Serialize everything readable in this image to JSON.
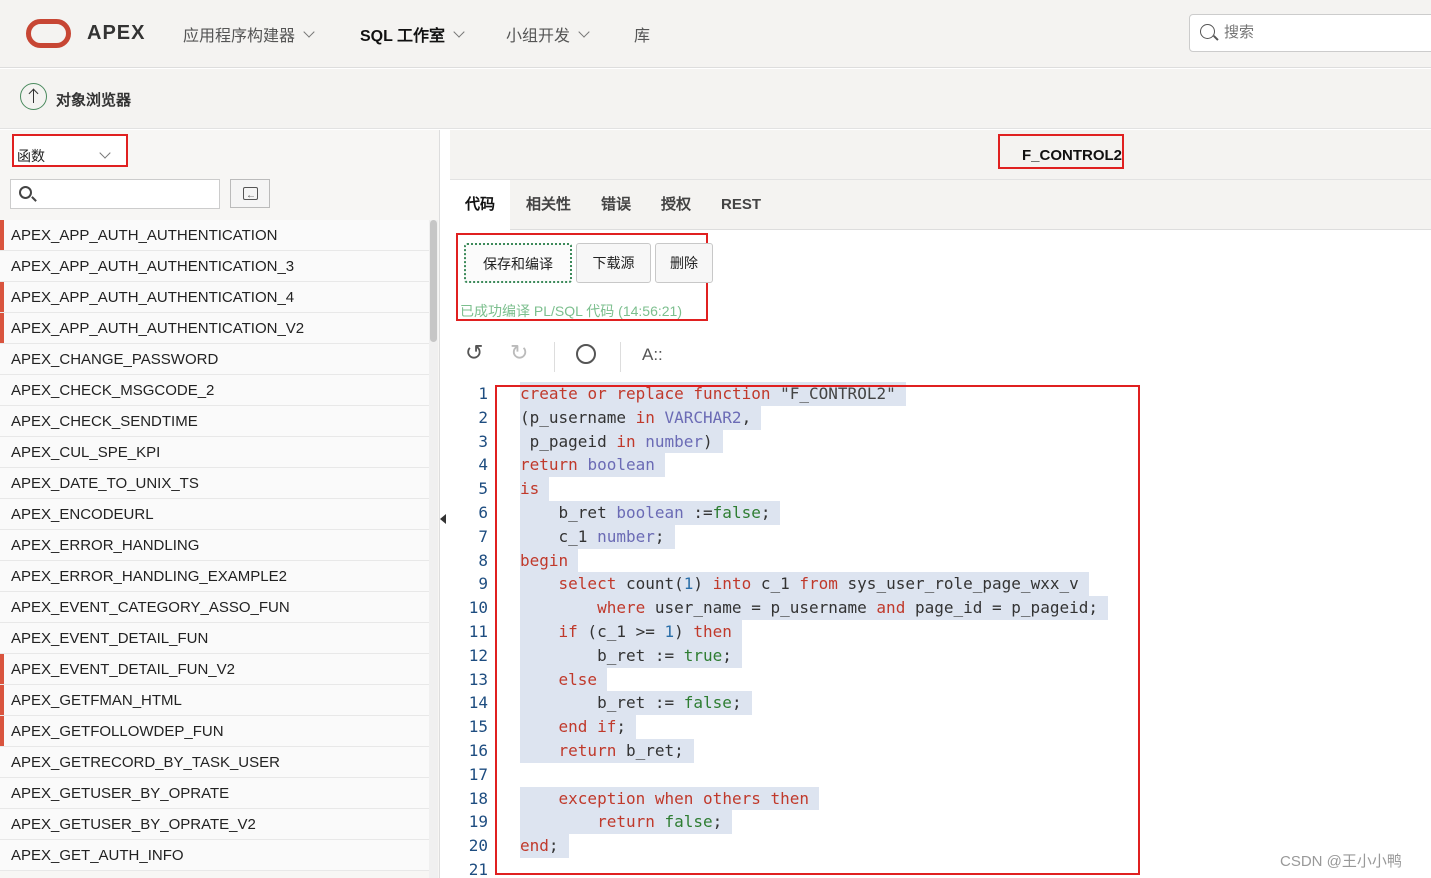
{
  "header": {
    "brand": "APEX",
    "nav": [
      {
        "label": "应用程序构建器",
        "has_menu": true,
        "active": false
      },
      {
        "label": "SQL 工作室",
        "has_menu": true,
        "active": true
      },
      {
        "label": "小组开发",
        "has_menu": true,
        "active": false
      },
      {
        "label": "库",
        "has_menu": false,
        "active": false
      }
    ],
    "search_placeholder": "搜索"
  },
  "subbar": {
    "title": "对象浏览器"
  },
  "left": {
    "type_selected": "函数",
    "items": [
      {
        "label": "APEX_APP_AUTH_AUTHENTICATION",
        "marked": true
      },
      {
        "label": "APEX_APP_AUTH_AUTHENTICATION_3",
        "marked": false
      },
      {
        "label": "APEX_APP_AUTH_AUTHENTICATION_4",
        "marked": true
      },
      {
        "label": "APEX_APP_AUTH_AUTHENTICATION_V2",
        "marked": true
      },
      {
        "label": "APEX_CHANGE_PASSWORD",
        "marked": false
      },
      {
        "label": "APEX_CHECK_MSGCODE_2",
        "marked": false
      },
      {
        "label": "APEX_CHECK_SENDTIME",
        "marked": false
      },
      {
        "label": "APEX_CUL_SPE_KPI",
        "marked": false
      },
      {
        "label": "APEX_DATE_TO_UNIX_TS",
        "marked": false
      },
      {
        "label": "APEX_ENCODEURL",
        "marked": false
      },
      {
        "label": "APEX_ERROR_HANDLING",
        "marked": false
      },
      {
        "label": "APEX_ERROR_HANDLING_EXAMPLE2",
        "marked": false
      },
      {
        "label": "APEX_EVENT_CATEGORY_ASSO_FUN",
        "marked": false
      },
      {
        "label": "APEX_EVENT_DETAIL_FUN",
        "marked": false
      },
      {
        "label": "APEX_EVENT_DETAIL_FUN_V2",
        "marked": true
      },
      {
        "label": "APEX_GETFMAN_HTML",
        "marked": true
      },
      {
        "label": "APEX_GETFOLLOWDEP_FUN",
        "marked": true
      },
      {
        "label": "APEX_GETRECORD_BY_TASK_USER",
        "marked": false
      },
      {
        "label": "APEX_GETUSER_BY_OPRATE",
        "marked": false
      },
      {
        "label": "APEX_GETUSER_BY_OPRATE_V2",
        "marked": false
      },
      {
        "label": "APEX_GET_AUTH_INFO",
        "marked": false
      }
    ]
  },
  "object": {
    "title": "F_CONTROL2",
    "tabs": [
      "代码",
      "相关性",
      "错误",
      "授权",
      "REST"
    ],
    "active_tab": "代码",
    "buttons": {
      "save_compile": "保存和编译",
      "download": "下载源",
      "delete": "删除"
    },
    "status": "已成功编译 PL/SQL 代码 (14:56:21)",
    "toolbar_case_label": "A::"
  },
  "code_lines": [
    "create or replace function \"F_CONTROL2\"",
    "(p_username in VARCHAR2,",
    " p_pageid in number)",
    "return boolean",
    "is",
    "    b_ret boolean :=false;",
    "    c_1 number;",
    "begin",
    "    select count(1) into c_1 from sys_user_role_page_wxx_v",
    "        where user_name = p_username and page_id = p_pageid;",
    "    if (c_1 >= 1) then",
    "        b_ret := true;",
    "    else",
    "        b_ret := false;",
    "    end if;",
    "    return b_ret;",
    "",
    "    exception when others then",
    "        return false;",
    "end;",
    ""
  ],
  "watermark": "CSDN @王小小鸭",
  "colors": {
    "accent": "#c74634",
    "highlight_box": "#e02020",
    "success": "#7cbf8e"
  }
}
